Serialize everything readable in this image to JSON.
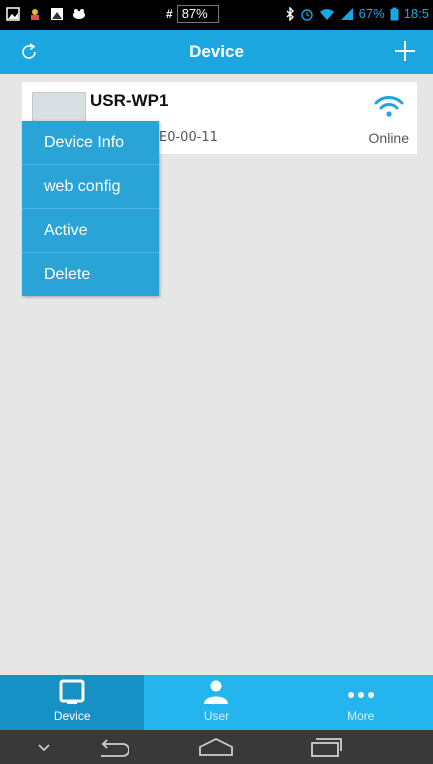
{
  "status_bar": {
    "battery_center": "87%",
    "battery_right": "67%",
    "time": "18:5"
  },
  "header": {
    "title": "Device",
    "left_icon": "refresh-icon",
    "right_icon": "plus-icon",
    "background": "#1ca6e0"
  },
  "device": {
    "name": "USR-WP1",
    "mac_partial": "E0-00-11",
    "status": "Online",
    "icon": "wifi-icon"
  },
  "context_menu": {
    "items": [
      {
        "label": "Device Info"
      },
      {
        "label": "web config"
      },
      {
        "label": "Active"
      },
      {
        "label": "Delete"
      }
    ]
  },
  "tabs": [
    {
      "label": "Device",
      "icon": "tablet-icon",
      "active": true
    },
    {
      "label": "User",
      "icon": "user-icon",
      "active": false
    },
    {
      "label": "More",
      "icon": "more-dots-icon",
      "active": false
    }
  ],
  "colors": {
    "accent": "#1ca6e0",
    "tab_bar": "#25b5ee",
    "tab_active": "#1691c6",
    "menu": "#2aa3d7"
  }
}
